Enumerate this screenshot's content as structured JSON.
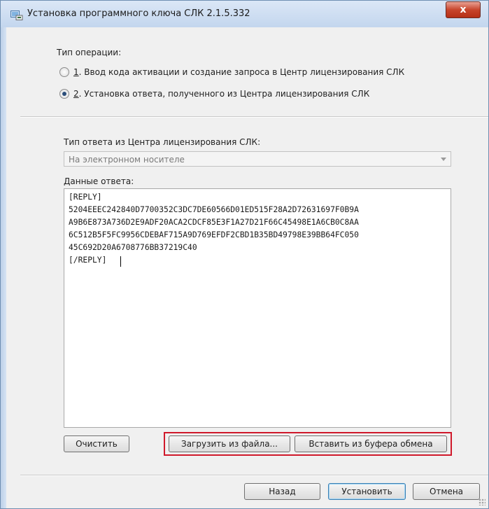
{
  "window": {
    "title": "Установка программного ключа СЛК 2.1.5.332",
    "close_label": "x"
  },
  "operation": {
    "label": "Тип операции:",
    "options": [
      {
        "num": "1",
        "rest": ". Ввод кода активации и создание запроса в Центр лицензирования СЛК",
        "selected": false
      },
      {
        "num": "2",
        "rest": ". Установка ответа, полученного из Центра лицензирования СЛК",
        "selected": true
      }
    ]
  },
  "response_type": {
    "label": "Тип ответа из Центра лицензирования СЛК:",
    "value": "На электронном носителе"
  },
  "response_data": {
    "label": "Данные ответа:",
    "lines": [
      "[REPLY]",
      "5204EEEC242840D7700352C3DC7DE60566D01ED515F28A2D72631697F0B9A",
      "A9B6E873A736D2E9ADF20ACA2CDCF85E3F1A27D21F66C45498E1A6CB0C8AA",
      "6C512B5F5FC9956CDEBAF715A9D769EFDF2CBD1B35BD49798E39BB64FC050",
      "45C692D20A6708776BB37219C40",
      "[/REPLY]"
    ]
  },
  "buttons": {
    "clear": "Очистить",
    "load_file": "Загрузить из файла...",
    "paste_clipboard": "Вставить из буфера обмена",
    "back": "Назад",
    "install": "Установить",
    "cancel": "Отмена"
  },
  "colors": {
    "highlight": "#d0192b",
    "close_button": "#c7452c"
  }
}
